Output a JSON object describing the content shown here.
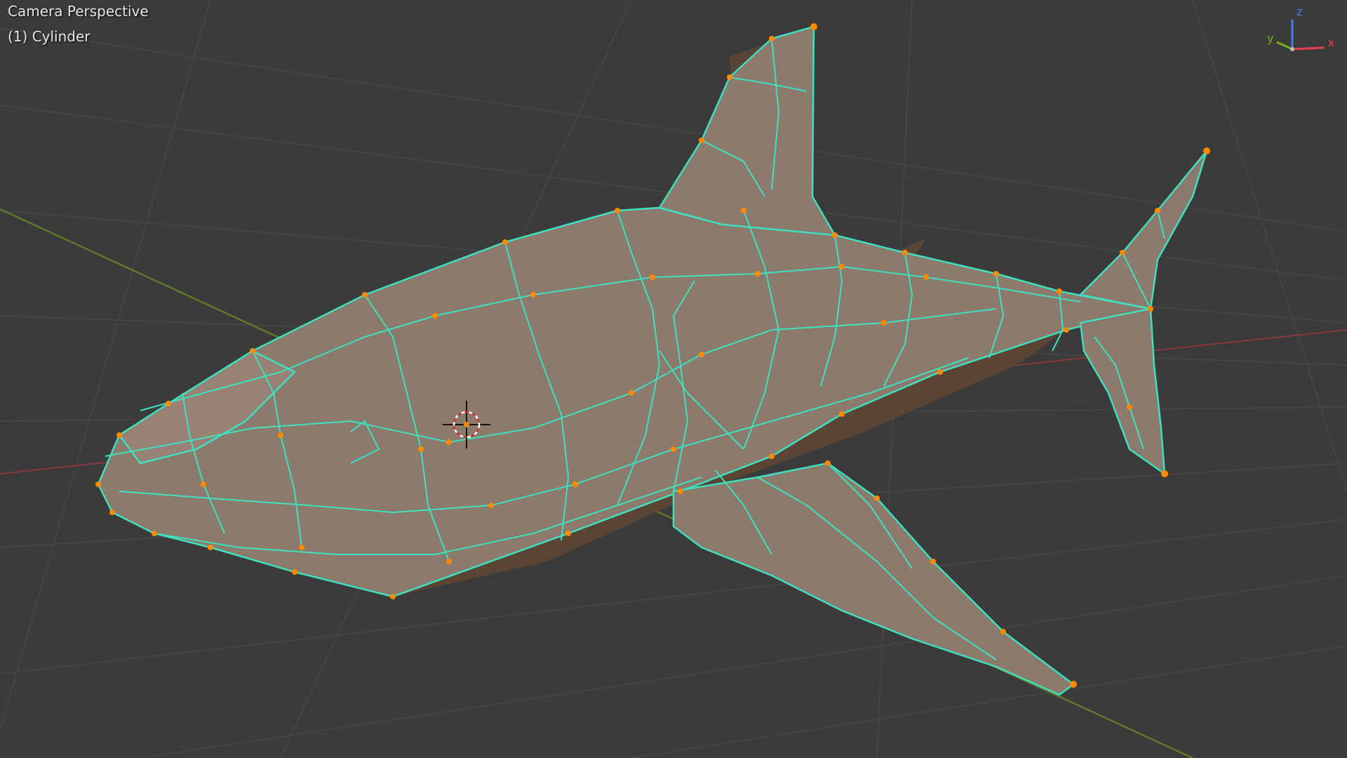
{
  "viewport": {
    "view_title": "Camera Perspective",
    "object_label": "(1) Cylinder"
  },
  "gizmo": {
    "x_label": "x",
    "y_label": "y",
    "z_label": "z",
    "x_color": "#e8404a",
    "y_color": "#78b21a",
    "z_color": "#3c82e6"
  },
  "theme": {
    "background": "#3b3b3b",
    "grid_line": "#4a4a4a",
    "x_axis_line": "#8a3a3a",
    "y_axis_line": "#5f7a2a",
    "wire_edge": "#3ee0c0",
    "vertex": "#ff8a00",
    "face_light": "#8c7a6c",
    "face_dark": "#5a4434"
  },
  "tool_icons": {
    "cursor": "3d-cursor-icon"
  }
}
